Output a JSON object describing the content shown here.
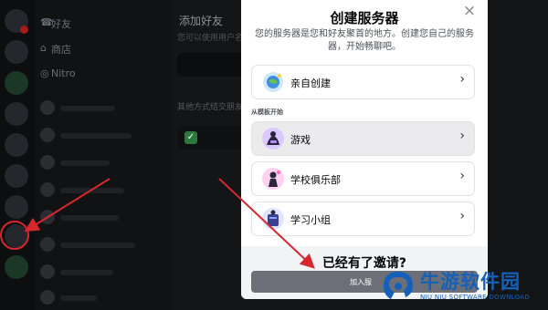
{
  "modal": {
    "title": "创建服务器",
    "close": "×",
    "description": "您的服务器是您和好友聚首的地方。创建您自己的服务器，开始畅聊吧。",
    "options_top": [
      {
        "label": "亲自创建",
        "icon": "globe-icon"
      }
    ],
    "section_label": "从模板开始",
    "templates": [
      {
        "label": "游戏",
        "icon": "gaming-icon"
      },
      {
        "label": "学校俱乐部",
        "icon": "school-club-icon"
      },
      {
        "label": "学习小组",
        "icon": "study-group-icon"
      }
    ],
    "invite_title": "已经有了邀请?",
    "join_button": "加入服"
  },
  "main": {
    "title": "添加好友",
    "subtitle": "您可以使用用户名添加好友，的名字",
    "section": "其他方式结交朋友",
    "channels_friends": "好友",
    "channels_shop": "商店",
    "channels_nitro": "Nitro"
  },
  "watermark": {
    "brand": "牛游软件园",
    "sub": "NIU NIU SOFTWARE DOWNLOAD"
  },
  "colors": {
    "annotation_red": "#d4282e",
    "brand_blue": "#1560b8"
  }
}
